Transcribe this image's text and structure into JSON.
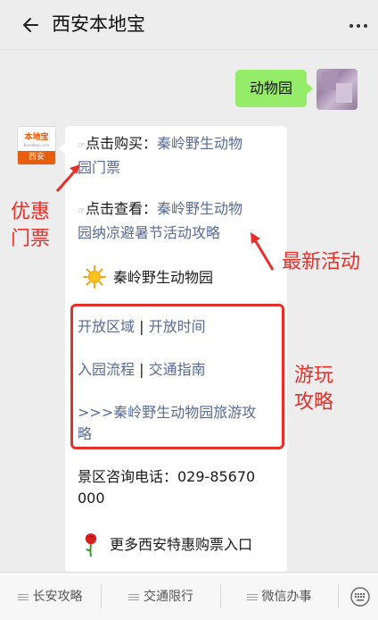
{
  "header": {
    "title": "西安本地宝",
    "back_icon": "arrow-left-icon",
    "more_icon": "more-dots-icon"
  },
  "user_message": {
    "text": "动物园"
  },
  "bot_avatar": {
    "logo_text": "本地宝",
    "logo_sub": "Bendibao.com",
    "city": "西安"
  },
  "bot_message": {
    "hand_glyph": "☞",
    "buy_prefix": "点击购买：",
    "buy_link_line1": "秦岭野生动物",
    "buy_link_line2": "园门票",
    "view_prefix": "点击查看：",
    "view_link_line1": "秦岭野生动物",
    "view_link_line2": "园纳凉避暑节活动攻略",
    "park_name": "秦岭野生动物园",
    "link_open_area": "开放区域",
    "sep1": " | ",
    "link_open_time": "开放时间",
    "link_entry": "入园流程",
    "sep2": " | ",
    "link_transport": "交通指南",
    "guide_line1": ">>>秦岭野生动物园旅游攻",
    "guide_line2": "略",
    "phone_line1": "景区咨询电话：029-85670",
    "phone_line2": "000",
    "more_tickets": "更多西安特惠购票入口"
  },
  "annotations": {
    "discount_line1": "优惠",
    "discount_line2": "门票",
    "latest": "最新活动",
    "guide_line1": "游玩",
    "guide_line2": "攻略"
  },
  "bottom_menu": [
    {
      "label": "长安攻略"
    },
    {
      "label": "交通限行"
    },
    {
      "label": "微信办事"
    }
  ],
  "colors": {
    "link": "#576b95",
    "annotation": "#e8302a",
    "my_bubble": "#95ec69",
    "brand": "#e95d0f"
  }
}
